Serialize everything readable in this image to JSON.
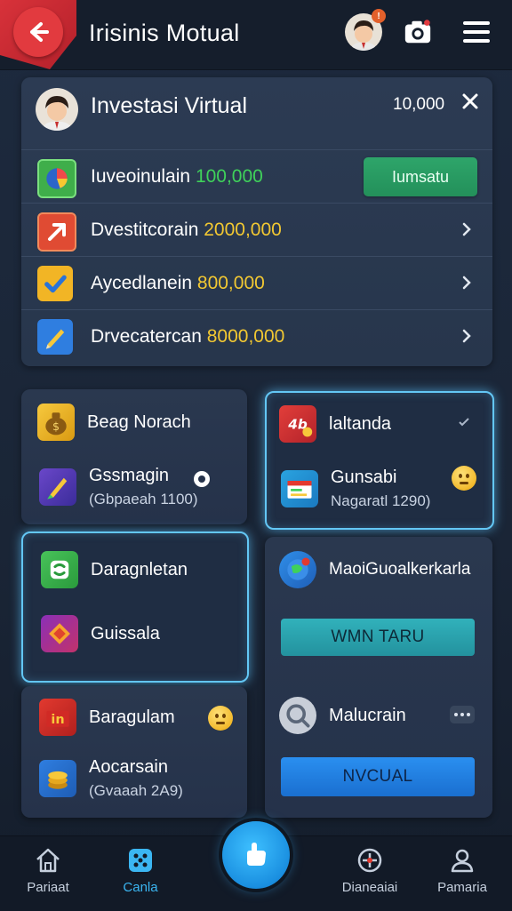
{
  "header": {
    "title": "Irisinis Motual",
    "badge": "!"
  },
  "investment_card": {
    "title": "Investasi Virtual",
    "amount": "10,000",
    "rows": [
      {
        "label": "Iuveoinulain",
        "value": "100,000",
        "value_color": "#3fd15a",
        "action": "Iumsatu"
      },
      {
        "label": "Dvestitcorain",
        "value": "2000,000",
        "value_color": "#f2c832"
      },
      {
        "label": "Aycedlanein",
        "value": "800,000",
        "value_color": "#f2c832"
      },
      {
        "label": "Drvecatercan",
        "value": "8000,000",
        "value_color": "#f2c832"
      }
    ]
  },
  "left_column": {
    "card1": {
      "item1": {
        "title": "Beag Norach"
      },
      "item2": {
        "title": "Gssmagin",
        "sub": "(Gbpaeah 1100)"
      }
    },
    "card2": {
      "item1": {
        "title": "Daragnletan"
      },
      "item2": {
        "title": "Guissala"
      }
    },
    "card3": {
      "item1": {
        "title": "Baragulam"
      },
      "item2": {
        "title": "Aocarsain",
        "sub": "(Gvaaah 2A9)"
      }
    }
  },
  "right_column": {
    "card1": {
      "item1": {
        "title": "laltanda"
      },
      "item2": {
        "title": "Gunsabi",
        "sub": "Nagaratl 1290)"
      }
    },
    "card2": {
      "item1": {
        "title": "MaoiGuoalkerkarla"
      },
      "button1": "WMN TARU",
      "item2": {
        "title": "Malucrain"
      },
      "button2": "NVCUAL"
    }
  },
  "bottom_nav": {
    "items": [
      {
        "label": "Pariaat",
        "icon": "home-icon"
      },
      {
        "label": "Canla",
        "icon": "game-icon"
      },
      {
        "label": "Dianeaiai",
        "icon": "compass-icon"
      },
      {
        "label": "Pamaria",
        "icon": "profile-icon"
      }
    ],
    "fab_icon": "hand-icon"
  },
  "colors": {
    "accent_blue": "#3bb6f2",
    "back_red": "#e23a3f",
    "action_green": "#2ea56a",
    "button_teal": "#2aa4b0",
    "button_blue": "#1e7fe0"
  }
}
